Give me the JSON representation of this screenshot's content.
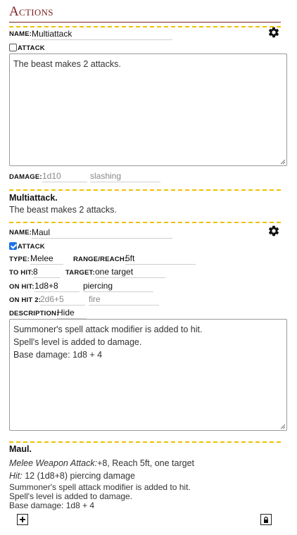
{
  "section": {
    "title": "Actions"
  },
  "action1": {
    "name_label": "Name:",
    "name_value": "Multiattack",
    "attack_label": "Attack",
    "attack_checked": false,
    "description_text": "The beast makes 2 attacks.",
    "damage_label": "Damage:",
    "damage_dice_placeholder": "1d10",
    "damage_type_placeholder": "slashing",
    "preview_title": "Multiattack.",
    "preview_text": "The beast makes 2 attacks."
  },
  "action2": {
    "name_label": "Name:",
    "name_value": "Maul",
    "attack_label": "Attack",
    "attack_checked": true,
    "type_label": "Type:",
    "type_value": "Melee",
    "range_label": "Range/Reach:",
    "range_value": "5ft",
    "tohit_label": "To Hit:",
    "tohit_value": "8",
    "target_label": "Target:",
    "target_value": "one target",
    "onhit_label": "On Hit:",
    "onhit_dice": "1d8+8",
    "onhit_type": "piercing",
    "onhit2_label": "On Hit 2:",
    "onhit2_dice_placeholder": "2d6+5",
    "onhit2_type_placeholder": "fire",
    "description_label": "Description:",
    "description_mode": "Hide",
    "textarea_lines": [
      "Summoner's spell attack modifier is added to hit.",
      "Spell's level is added to damage.",
      "Base damage: 1d8 + 4"
    ],
    "preview_title": "Maul.",
    "preview_attack_italic": "Melee Weapon Attack:",
    "preview_attack_rest": "+8, Reach 5ft, one target",
    "preview_hit_italic": "Hit:",
    "preview_hit_rest": " 12 (1d8+8) piercing damage",
    "preview_lines": [
      "Summoner's spell attack modifier is added to hit.",
      "Spell's level is added to damage.",
      "Base damage: 1d8 + 4"
    ]
  },
  "icons": {
    "gear": "gear-icon",
    "add": "plus-icon",
    "lock": "lock-icon"
  },
  "colors": {
    "title": "#7a2020",
    "dash": "#f0c000",
    "checkbox": "#1a73e8"
  }
}
